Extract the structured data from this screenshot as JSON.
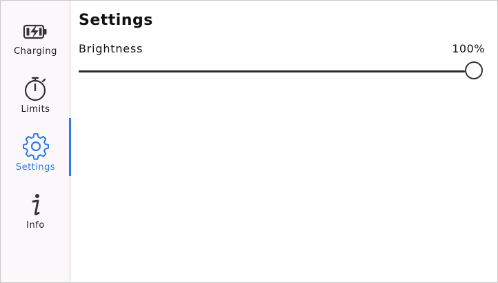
{
  "sidebar": {
    "items": [
      {
        "label": "Charging",
        "icon": "charging-battery-icon",
        "active": false
      },
      {
        "label": "Limits",
        "icon": "stopwatch-icon",
        "active": false
      },
      {
        "label": "Settings",
        "icon": "gear-icon",
        "active": true
      },
      {
        "label": "Info",
        "icon": "info-icon",
        "active": false
      }
    ]
  },
  "main": {
    "title": "Settings",
    "brightness": {
      "label": "Brightness",
      "value_text": "100%",
      "value_fraction": 1.0
    }
  },
  "colors": {
    "accent": "#2a7de1",
    "sidebar_bg": "#fbf7fb",
    "text": "#111111"
  }
}
